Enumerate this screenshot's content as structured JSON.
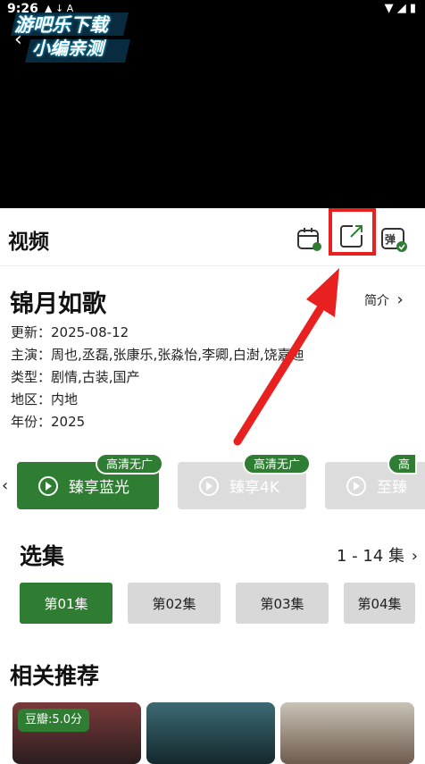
{
  "status_bar": {
    "time": "9:26"
  },
  "watermark": {
    "line1": "游吧乐下载",
    "line2": "小编亲测"
  },
  "header": {
    "title": "视频"
  },
  "drama": {
    "title": "锦月如歌",
    "intro_label": "简介",
    "updated": "更新：2025-08-12",
    "cast": "主演：周也,丞磊,张康乐,张淼怡,李卿,白澍,饶嘉迪",
    "genre": "类型：剧情,古装,国产",
    "region": "地区：内地",
    "year": "年份：2025"
  },
  "sources": [
    {
      "label": "臻享蓝光",
      "badge": "高清无广"
    },
    {
      "label": "臻享4K",
      "badge": "高清无广"
    },
    {
      "label": "至臻",
      "badge": "高"
    }
  ],
  "episodes": {
    "title": "选集",
    "range": "1 - 14 集",
    "items": [
      "第01集",
      "第02集",
      "第03集",
      "第04集"
    ]
  },
  "recommend": {
    "title": "相关推荐",
    "rating": "豆瓣:5.0分"
  },
  "colors": {
    "accent": "#2e7d32",
    "annotation": "#e8201f"
  },
  "icons": [
    "calendar-tv-icon",
    "share-icon",
    "danmaku-icon",
    "chevron-right-icon",
    "play-circle-icon"
  ]
}
